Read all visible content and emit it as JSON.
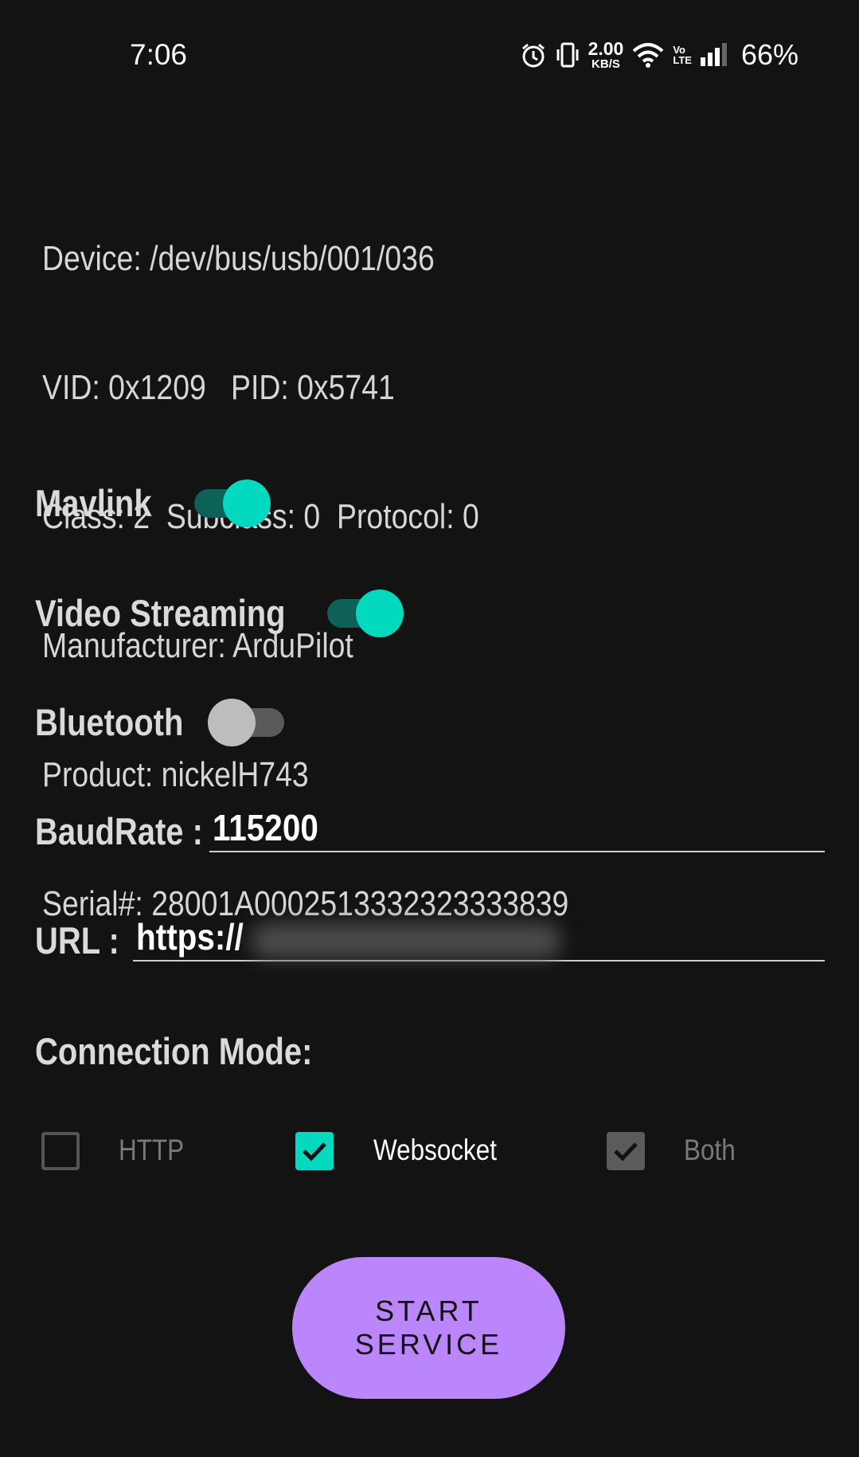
{
  "status_bar": {
    "time": "7:06",
    "net_speed_value": "2.00",
    "net_speed_unit": "KB/S",
    "volte_top": "Vo",
    "volte_bottom": "LTE",
    "battery": "66%",
    "icons": [
      "alarm-icon",
      "vibrate-icon",
      "wifi-icon",
      "volte-icon",
      "signal-icon"
    ]
  },
  "device_info": {
    "line1": "Device: /dev/bus/usb/001/036",
    "line2": "VID: 0x1209   PID: 0x5741",
    "line3": "Class: 2  Subclass: 0  Protocol: 0",
    "line4": "Manufacturer: ArduPilot",
    "line5": "Product: nickelH743",
    "line6": "Serial#: 28001A0002513332323333839"
  },
  "toggles": {
    "mavlink": {
      "label": "Mavlink",
      "on": true
    },
    "video": {
      "label": "Video Streaming",
      "on": true
    },
    "bluetooth": {
      "label": "Bluetooth",
      "on": false
    }
  },
  "baud": {
    "label": "BaudRate :",
    "value": "115200"
  },
  "url": {
    "label": "URL :",
    "value": "https://"
  },
  "connection": {
    "label": "Connection Mode:",
    "options": [
      {
        "label": "HTTP",
        "checked": false
      },
      {
        "label": "Websocket",
        "checked": true
      },
      {
        "label": "Both",
        "checked": true
      }
    ]
  },
  "start_button": {
    "label": "START SERVICE"
  },
  "colors": {
    "background": "#131313",
    "accent_teal": "#03d9bf",
    "button_purple": "#bb86fc"
  }
}
